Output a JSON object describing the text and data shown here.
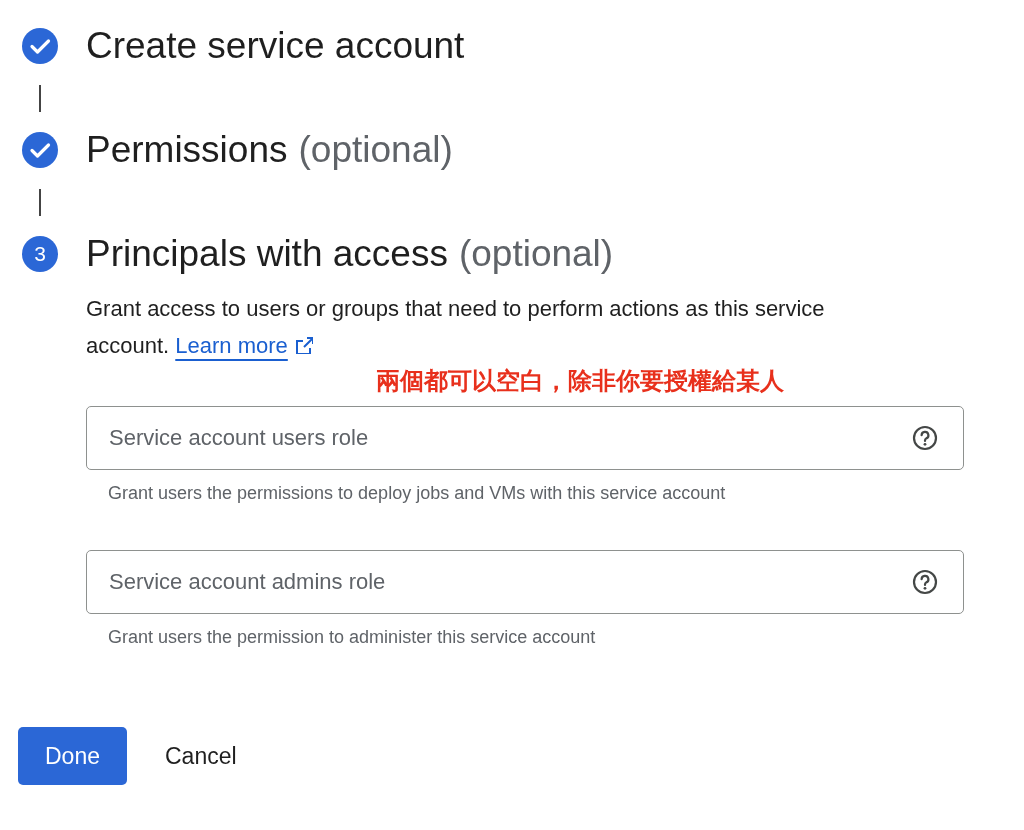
{
  "steps": [
    {
      "done": true,
      "title": "Create service account"
    },
    {
      "done": true,
      "title": "Permissions",
      "suffix": "(optional)"
    },
    {
      "done": false,
      "number": "3",
      "title": "Principals with access",
      "suffix": "(optional)"
    }
  ],
  "description": {
    "text": "Grant access to users or groups that need to perform actions as this service account.",
    "link": "Learn more"
  },
  "annotation": "兩個都可以空白，除非你要授權給某人",
  "fields": [
    {
      "placeholder": "Service account users role",
      "hint": "Grant users the permissions to deploy jobs and VMs with this service account"
    },
    {
      "placeholder": "Service account admins role",
      "hint": "Grant users the permission to administer this service account"
    }
  ],
  "buttons": [
    {
      "label": "Done",
      "kind": "primary"
    },
    {
      "label": "Cancel",
      "kind": "text"
    }
  ]
}
